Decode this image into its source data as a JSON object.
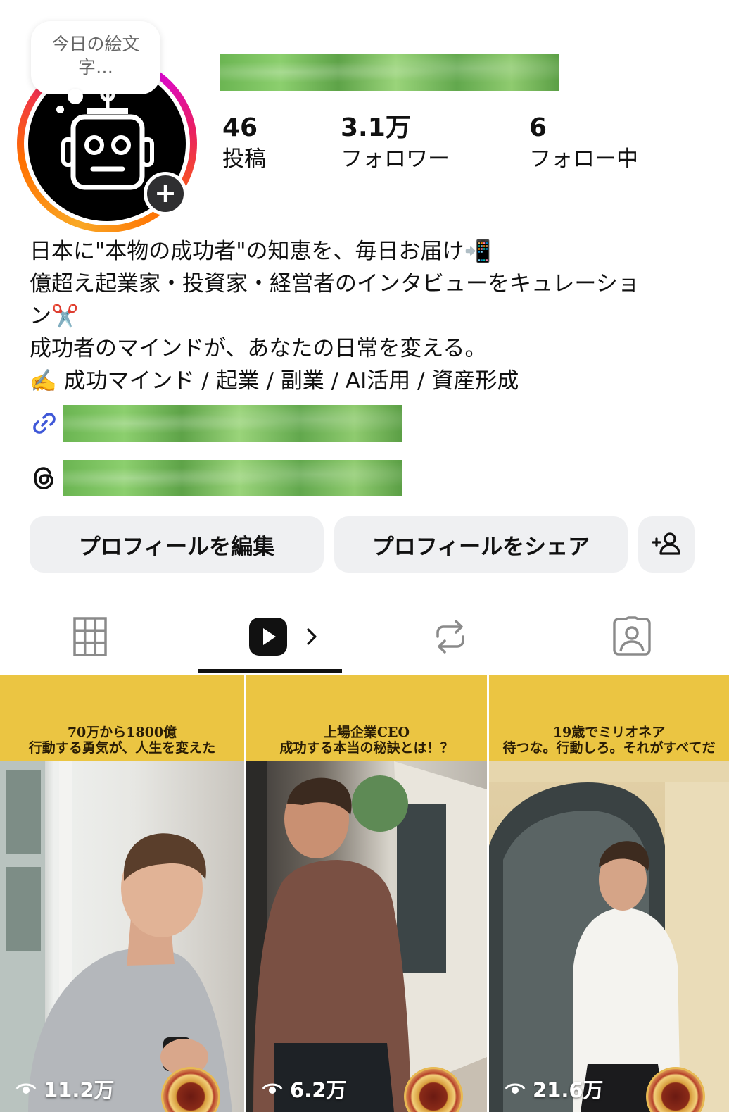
{
  "profile": {
    "note": "今日の絵文字…",
    "add_story_symbol": "+"
  },
  "stats": [
    {
      "value": "46",
      "label": "投稿"
    },
    {
      "value": "3.1万",
      "label": "フォロワー"
    },
    {
      "value": "6",
      "label": "フォロー中"
    }
  ],
  "bio": {
    "line1": "日本に\"本物の成功者\"の知恵を、毎日お届け📲",
    "line2": "億超え起業家・投資家・経営者のインタビューをキュレーショ",
    "line3": "ン✂️",
    "line4": "成功者のマインドが、あなたの日常を変える。",
    "line5": "✍️ 成功マインド / 起業 / 副業 / AI活用 / 資産形成"
  },
  "buttons": {
    "edit": "プロフィールを編集",
    "share": "プロフィールをシェア"
  },
  "tabs": [
    "grid-icon",
    "reels-icon",
    "reposts-icon",
    "tagged-icon"
  ],
  "active_tab": "reels",
  "reels": [
    {
      "line1": "70万から1800億",
      "line2": "行動する勇気が、人生を変えた",
      "views": "11.2万"
    },
    {
      "line1": "上場企業CEO",
      "line2": "成功する本当の秘訣とは！？",
      "views": "6.2万"
    },
    {
      "line1": "19歳でミリオネア",
      "line2": "待つな。行動しろ。それがすべてだ",
      "views": "21.6万"
    }
  ],
  "colors": {
    "banner": "#ebc542",
    "button_bg": "#eff0f2",
    "link_blue": "#3f58d8"
  }
}
